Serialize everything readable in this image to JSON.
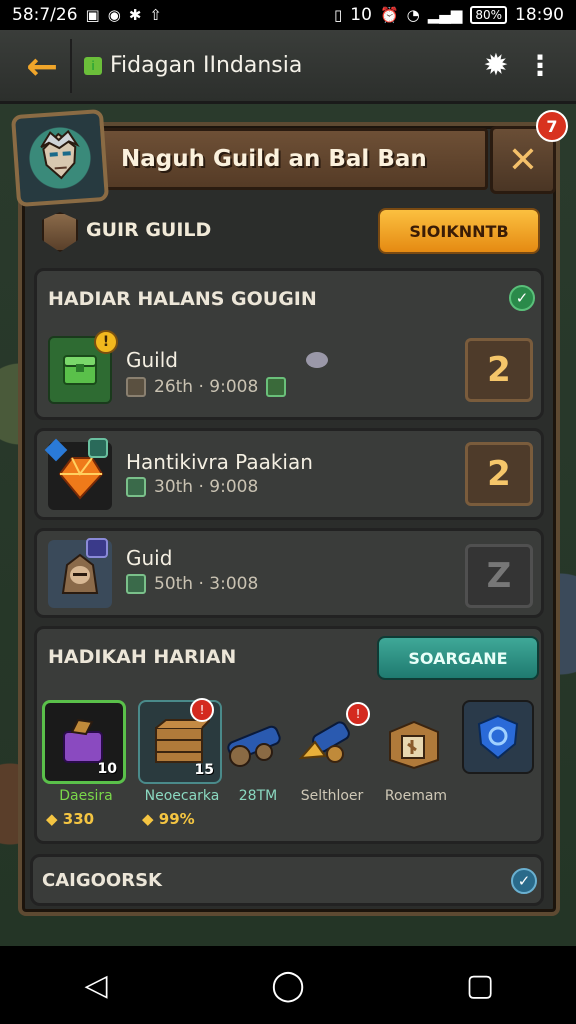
{
  "status_bar": {
    "time_left": "58:7/26",
    "right_text": "10",
    "battery": "80%",
    "time_right": "18:90"
  },
  "app_bar": {
    "title": "Fidagan IIndansia",
    "back_icon": "arrow-left-icon",
    "settings_icon": "gear-icon",
    "more_icon": "more-vert-icon"
  },
  "dialog": {
    "title": "Naguh Guild an Bal Ban",
    "close_badge": "7",
    "guild_label": "GUIR GUILD",
    "guild_button": "SIOIKNNTB"
  },
  "rewards_panel": {
    "heading": "HADIAR HALANS GOUGIN",
    "items": [
      {
        "name": "Guild",
        "meta": "26th · 9:008",
        "count": "2",
        "locked": false,
        "thumb_color": "#2e6b32",
        "badge": "!"
      },
      {
        "name": "Hantikivra Paakian",
        "meta": "30th · 9:008",
        "count": "2",
        "locked": false,
        "thumb_color": "#1d1d1d",
        "badge": ""
      },
      {
        "name": "Guid",
        "meta": "50th · 3:008",
        "count": "Z",
        "locked": true,
        "thumb_color": "#3a4a5a",
        "badge": ""
      }
    ]
  },
  "shop_panel": {
    "heading": "HADIKAH HARIAN",
    "button": "SOARGANE",
    "items": [
      {
        "name": "Daesira",
        "qty": "10",
        "price": "330",
        "selected": true,
        "tile_color": "#1a1a1a"
      },
      {
        "name": "Neoecarka",
        "qty": "15",
        "price": "99%",
        "selected": false,
        "tile_color": "#2a3a3e"
      },
      {
        "name": "28TM",
        "qty": "",
        "price": "",
        "selected": false,
        "tile_color": "transparent"
      },
      {
        "name": "Selthloer",
        "qty": "",
        "price": "",
        "selected": false,
        "tile_color": "transparent"
      },
      {
        "name": "Roemam",
        "qty": "",
        "price": "",
        "selected": false,
        "tile_color": "transparent"
      },
      {
        "name": "",
        "qty": "",
        "price": "",
        "selected": false,
        "tile_color": "#2a3a4a"
      }
    ]
  },
  "footer_panel": {
    "heading": "CAIGOORSK"
  },
  "nav_bar": {
    "back": "◁",
    "home": "◯",
    "recents": "▢"
  }
}
